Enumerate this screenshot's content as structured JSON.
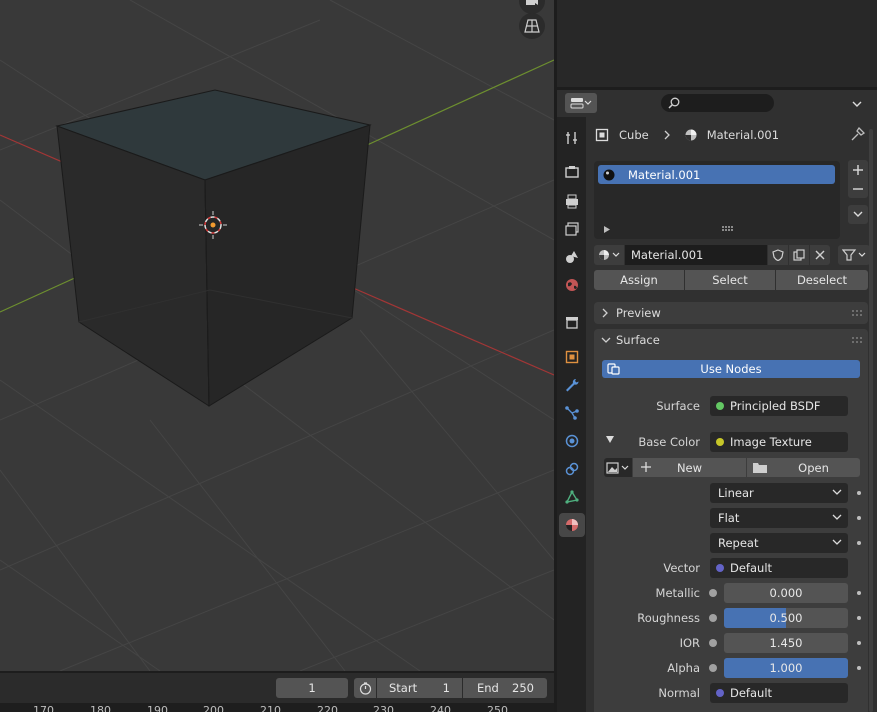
{
  "viewport": {
    "tools": [
      "camera-icon",
      "grid-view-icon"
    ]
  },
  "timeline": {
    "current_frame": "1",
    "start_label": "Start",
    "start_value": "1",
    "end_label": "End",
    "end_value": "250",
    "ruler_ticks": [
      "170",
      "180",
      "190",
      "200",
      "210",
      "220",
      "230",
      "240",
      "250"
    ]
  },
  "properties": {
    "breadcrumb": {
      "object": "Cube",
      "material": "Material.001"
    },
    "material_slots": [
      {
        "name": "Material.001",
        "selected": true
      }
    ],
    "material_name": "Material.001",
    "slot_buttons": {
      "assign": "Assign",
      "select": "Select",
      "deselect": "Deselect"
    },
    "panels": {
      "preview": "Preview",
      "surface": "Surface"
    },
    "use_nodes": "Use Nodes",
    "surface_label": "Surface",
    "surface_value": "Principled BSDF",
    "base_color_label": "Base Color",
    "base_color_value": "Image Texture",
    "image_new": "New",
    "image_open": "Open",
    "interpolation": "Linear",
    "projection": "Flat",
    "extension": "Repeat",
    "inputs": [
      {
        "label": "Vector",
        "type": "vector",
        "value": "Default"
      },
      {
        "label": "Metallic",
        "type": "slider",
        "value": "0.000",
        "fraction": 0.0
      },
      {
        "label": "Roughness",
        "type": "slider",
        "value": "0.500",
        "fraction": 0.5
      },
      {
        "label": "IOR",
        "type": "slider",
        "value": "1.450",
        "fraction": 0.0
      },
      {
        "label": "Alpha",
        "type": "slider",
        "value": "1.000",
        "fraction": 1.0
      },
      {
        "label": "Normal",
        "type": "vector",
        "value": "Default"
      }
    ],
    "tabs": [
      "tool-icon",
      "render-icon",
      "output-icon",
      "view-layer-icon",
      "scene-icon",
      "world-icon",
      "collection-icon",
      "object-icon",
      "modifier-icon",
      "particles-icon",
      "physics-icon",
      "constraints-icon",
      "data-icon",
      "material-icon"
    ],
    "active_tab": "material-icon"
  },
  "colors": {
    "accent": "#4772b3",
    "socket_green": "#63c763",
    "socket_yellow": "#c7c729",
    "socket_purple": "#6363c7",
    "socket_gray": "#a1a1a1",
    "x_axis": "#c63a3a",
    "y_axis": "#7fa23a"
  }
}
